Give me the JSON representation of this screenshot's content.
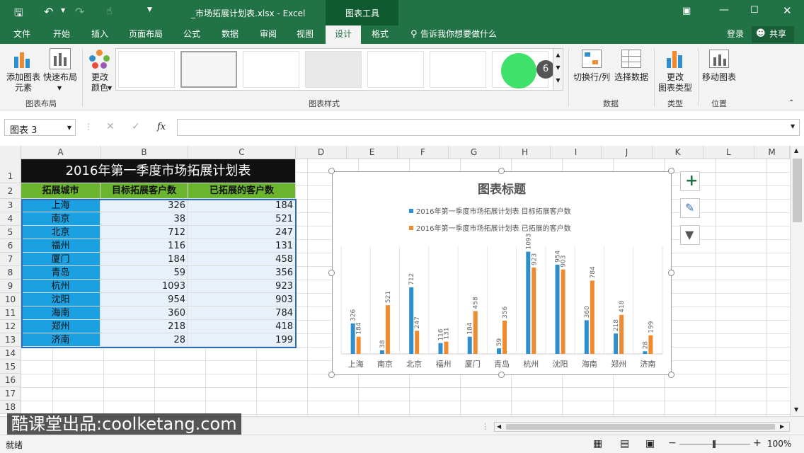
{
  "window": {
    "title": "_市场拓展计划表.xlsx - Excel",
    "context_tab": "图表工具"
  },
  "tabs": [
    "文件",
    "开始",
    "插入",
    "页面布局",
    "公式",
    "数据",
    "审阅",
    "视图",
    "设计",
    "格式"
  ],
  "tell_me": "告诉我你想要做什么",
  "signin": "登录",
  "share": "共享",
  "ribbon": {
    "add_element": "添加图表元素",
    "add_element_l1": "添加图表",
    "add_element_l2": "元素",
    "quick_layout": "快速布局",
    "change_color_l1": "更改",
    "change_color_l2": "颜色",
    "group_layout": "图表布局",
    "group_styles": "图表样式",
    "switch_rowcol": "切换行/列",
    "select_data": "选择数据",
    "group_data": "数据",
    "change_type_l1": "更改",
    "change_type_l2": "图表类型",
    "group_type": "类型",
    "move_chart": "移动图表",
    "group_location": "位置",
    "badge": "6"
  },
  "namebox": "图表 3",
  "fx": "fx",
  "columns": [
    "A",
    "B",
    "C",
    "D",
    "E",
    "F",
    "G",
    "H",
    "I",
    "J",
    "K",
    "L",
    "M"
  ],
  "rows": [
    "1",
    "2",
    "3",
    "4",
    "5",
    "6",
    "7",
    "8",
    "9",
    "10",
    "11",
    "12",
    "13",
    "14",
    "15",
    "16",
    "17",
    "18"
  ],
  "sheet": {
    "title": "2016年第一季度市场拓展计划表",
    "headers": [
      "拓展城市",
      "目标拓展客户数",
      "已拓展的客户数"
    ],
    "data": [
      [
        "上海",
        "326",
        "184"
      ],
      [
        "南京",
        "38",
        "521"
      ],
      [
        "北京",
        "712",
        "247"
      ],
      [
        "福州",
        "116",
        "131"
      ],
      [
        "厦门",
        "184",
        "458"
      ],
      [
        "青岛",
        "59",
        "356"
      ],
      [
        "杭州",
        "1093",
        "923"
      ],
      [
        "沈阳",
        "954",
        "903"
      ],
      [
        "海南",
        "360",
        "784"
      ],
      [
        "郑州",
        "218",
        "418"
      ],
      [
        "济南",
        "28",
        "199"
      ]
    ]
  },
  "chart_data": {
    "type": "bar",
    "title": "图表标题",
    "categories": [
      "上海",
      "南京",
      "北京",
      "福州",
      "厦门",
      "青岛",
      "杭州",
      "沈阳",
      "海南",
      "郑州",
      "济南"
    ],
    "series": [
      {
        "name": "2016年第一季度市场拓展计划表 目标拓展客户数",
        "color": "#2e8fcc",
        "values": [
          326,
          38,
          712,
          116,
          184,
          59,
          1093,
          954,
          360,
          218,
          28
        ]
      },
      {
        "name": "2016年第一季度市场拓展计划表 已拓展的客户数",
        "color": "#f08a2e",
        "values": [
          184,
          521,
          247,
          131,
          458,
          356,
          923,
          903,
          784,
          418,
          199
        ]
      }
    ],
    "legend": "top",
    "grid": "vertical"
  },
  "status": {
    "ready": "就绪",
    "zoom": "100%"
  },
  "watermark": "酷课堂出品:coolketang.com"
}
